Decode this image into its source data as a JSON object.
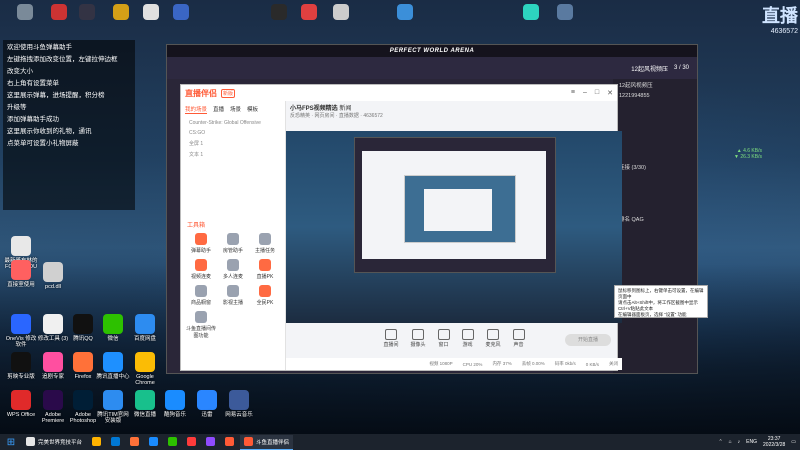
{
  "desktop": {
    "top_icons": [
      {
        "label": "",
        "color": "#7a8a99"
      },
      {
        "label": "",
        "color": "#cc3333"
      },
      {
        "label": "",
        "color": "#333344"
      },
      {
        "label": "",
        "color": "#d4a017"
      },
      {
        "label": "",
        "color": "#e0e0e0"
      },
      {
        "label": "",
        "color": "#3a66c4"
      },
      {
        "label": "",
        "color": "#2a2a2a"
      },
      {
        "label": "",
        "color": "#e04040"
      },
      {
        "label": "",
        "color": "#cccccc"
      },
      {
        "label": "",
        "color": "#3b8fd9"
      },
      {
        "label": "",
        "color": "#2dd4bf"
      },
      {
        "label": "",
        "color": "#5a7aa0"
      }
    ],
    "left_icons": [
      {
        "label": "最新哥布林的 FCDiaryCDU",
        "color": "#e8e8e8"
      },
      {
        "label": "直接室使用",
        "color": "#ff6060"
      },
      {
        "label": "pcd.dll",
        "color": "#d0d0d0"
      },
      {
        "label": "OneVis 修改软件",
        "color": "#2a66ff"
      },
      {
        "label": "修改工具 (3)",
        "color": "#f0f0f0"
      },
      {
        "label": "腾讯QQ",
        "color": "#111111"
      },
      {
        "label": "微信",
        "color": "#2dc100"
      },
      {
        "label": "百度网盘",
        "color": "#2d8cf0"
      },
      {
        "label": "剪映专业版",
        "color": "#111111"
      },
      {
        "label": "追剧专家",
        "color": "#ff4fa0"
      },
      {
        "label": "Firefox",
        "color": "#ff7139"
      },
      {
        "label": "腾讯直播中心",
        "color": "#1e90ff"
      },
      {
        "label": "Google Chrome",
        "color": "#fbbc05"
      },
      {
        "label": "WPS Office",
        "color": "#e02a2a"
      },
      {
        "label": "Adobe Premiere",
        "color": "#2a0a4a"
      },
      {
        "label": "Adobe Photoshop",
        "color": "#001e36"
      },
      {
        "label": "腾讯TIM官网安装版",
        "color": "#2d8cf0"
      },
      {
        "label": "微信直播",
        "color": "#18c08c"
      },
      {
        "label": "酷狗音乐",
        "color": "#1a8cff"
      },
      {
        "label": "迅雷",
        "color": "#2a86ff"
      },
      {
        "label": "网易云音乐",
        "color": "#3c5a9a"
      }
    ]
  },
  "overlay": {
    "lines": [
      "欢迎使用斗鱼弹幕助手",
      "左键拖拽添加改变位置，左键拉伸边框",
      "改变大小",
      "右上角有设置菜单",
      "这里展示弹幕，进场提醒，积分榜",
      "升级等",
      "添加弹幕助手成功",
      "",
      "这里展示你收到的礼物，通讯",
      "",
      "点菜单可设置小礼物屏蔽"
    ]
  },
  "widget": {
    "title": "直播",
    "number": "4636572",
    "up_speed": "4.6 KB/s",
    "down_speed": "26.3 KB/s"
  },
  "arena": {
    "title": "PERFECT WORLD ARENA",
    "room": "12起风视频压",
    "count": "3 / 30",
    "right_rows": [
      "12起风视频压",
      "1221994855",
      "连接 (3/30)",
      "排名 QAG"
    ]
  },
  "zhibo": {
    "app_name": "直播伴侣",
    "version_badge": "新版",
    "scene_tabs": [
      "我的场景",
      "直播",
      "场景",
      "模板"
    ],
    "scenes": [
      "Counter-Strike: Global Offensive",
      "CS:GO",
      "全屏 1",
      "文本 1"
    ],
    "tools_title": "工具箱",
    "tools": [
      {
        "label": "弹幕助手",
        "gray": false
      },
      {
        "label": "房管助手",
        "gray": true
      },
      {
        "label": "主播任务",
        "gray": true
      },
      {
        "label": "视频连麦",
        "gray": false
      },
      {
        "label": "多人连麦",
        "gray": true
      },
      {
        "label": "直播PK",
        "gray": false
      },
      {
        "label": "商品橱窗",
        "gray": true
      },
      {
        "label": "影视主播",
        "gray": true
      },
      {
        "label": "全民PK",
        "gray": false
      },
      {
        "label": "斗鱼直播间传图功能",
        "gray": true
      }
    ],
    "room_title": "小马FPS视频精选",
    "room_category": "新闻",
    "room_sub": "反恐精英 · 网页房间 · 直播数据 · 4636572",
    "bottom_tools": [
      "直播间",
      "摄像头",
      "窗口",
      "游戏",
      "麦克风",
      "声音"
    ],
    "start_label": "开始直播",
    "status": [
      "视频 1080P",
      "CPU 20%",
      "内存 37%",
      "丢帧 0.00%",
      "码率 0kb/s",
      "0 KB/s",
      "关闭"
    ]
  },
  "tooltip": {
    "lines": [
      "鼠标移到图标上，右键单击可设置，在编辑页面中",
      "请点击Alt+Shift中，将工作区截图中显示",
      "Ctrl+V粘贴此文本",
      "在编辑器面板页，选择 “设置” 功能"
    ]
  },
  "taskbar": {
    "items": [
      {
        "label": "完美世界竞技平台",
        "color": "#e6e6e6",
        "active": false
      },
      {
        "label": "",
        "color": "#ffb300",
        "active": false
      },
      {
        "label": "",
        "color": "#0078d4",
        "active": false
      },
      {
        "label": "",
        "color": "#ff7139",
        "active": false
      },
      {
        "label": "",
        "color": "#1a8cff",
        "active": false
      },
      {
        "label": "",
        "color": "#2dc100",
        "active": false
      },
      {
        "label": "",
        "color": "#ff3b3b",
        "active": false
      },
      {
        "label": "",
        "color": "#8f4bff",
        "active": false
      },
      {
        "label": "",
        "color": "#ff5a36",
        "active": false
      },
      {
        "label": "斗鱼直播伴侣",
        "color": "#ff5a36",
        "active": true
      }
    ],
    "lang": "ENG",
    "time": "23:37",
    "date": "2022/3/28"
  }
}
